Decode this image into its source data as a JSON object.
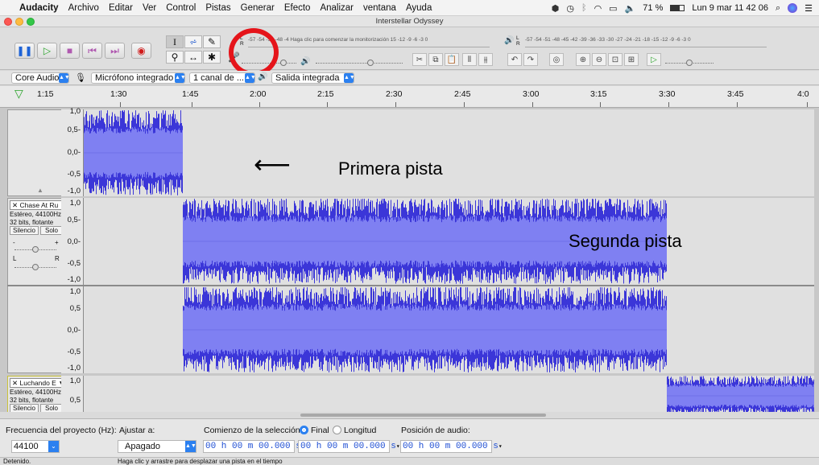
{
  "menubar": {
    "app_name": "Audacity",
    "items": [
      "Archivo",
      "Editar",
      "Ver",
      "Control",
      "Pistas",
      "Generar",
      "Efecto",
      "Analizar",
      "ventana",
      "Ayuda"
    ],
    "battery": "71 %",
    "clock": "Lun 9 mar  11 42 06"
  },
  "window": {
    "title": "Interstellar Odyssey"
  },
  "toolbar": {
    "record_meter_label": "-57  -54  -51  -48  -4 Haga clic para comenzar la monitorización 15  -12  -9  -6  -3  0",
    "playback_meter_label": "-57 -54 -51 -48 -45 -42 -39 -36 -33 -30 -27 -24 -21 -18 -15 -12  -9  -6  -3  0",
    "meter_lr": "L R"
  },
  "devices": {
    "host": "Core Audio",
    "input": "Micrófono integrado",
    "channels": "1 canal de ...",
    "output": "Salida integrada"
  },
  "timeline": {
    "start_label": "1:15",
    "ticks": [
      "1:30",
      "1:45",
      "2:00",
      "2:15",
      "2:30",
      "2:45",
      "3:00",
      "3:15",
      "3:30",
      "3:45",
      "4:0"
    ]
  },
  "tracks": [
    {
      "name": "",
      "scale": [
        "1,0",
        "0,5-",
        "0,0-",
        "-0,5",
        "-1,0"
      ],
      "annotation": "Primera pista"
    },
    {
      "name": "Chase At Ru",
      "info1": "Estéreo, 44100Hz",
      "info2": "32 bits, flotante",
      "mute": "Silencio",
      "solo": "Solo",
      "gain_minus": "-",
      "gain_plus": "+",
      "pan_l": "L",
      "pan_r": "R",
      "scale_top": [
        "1,0",
        "0,5-",
        "0,0-",
        "-0,5",
        "-1,0"
      ],
      "scale_bottom": [
        "1,0",
        "0,5",
        "0,0-",
        "-0,5",
        "-1,0"
      ],
      "annotation": "Segunda pista"
    },
    {
      "name": "Luchando E",
      "info1": "Estéreo, 44100Hz",
      "info2": "32 bits, flotante",
      "mute": "Silencio",
      "solo": "Solo",
      "scale": [
        "1,0",
        "0,5"
      ]
    }
  ],
  "selection_bar": {
    "rate_label": "Frecuencia del proyecto (Hz):",
    "rate_value": "44100",
    "snap_label": "Ajustar a:",
    "snap_value": "Apagado",
    "sel_start_label": "Comienzo de la selección:",
    "end_label": "Final",
    "length_label": "Longitud",
    "audio_pos_label": "Posición de audio:",
    "time1": "00 h 00 m 00.000 s",
    "time2": "00 h 00 m 00.000 s",
    "time3": "00 h 00 m 00.000 s"
  },
  "status": {
    "left": "Detenido.",
    "hint": "Haga clic y arrastre para desplazar una pista en el tiempo"
  },
  "colors": {
    "wave_dark": "#3b36d8",
    "wave_light": "#7f80f2",
    "annotation_circle": "#e5141a"
  }
}
